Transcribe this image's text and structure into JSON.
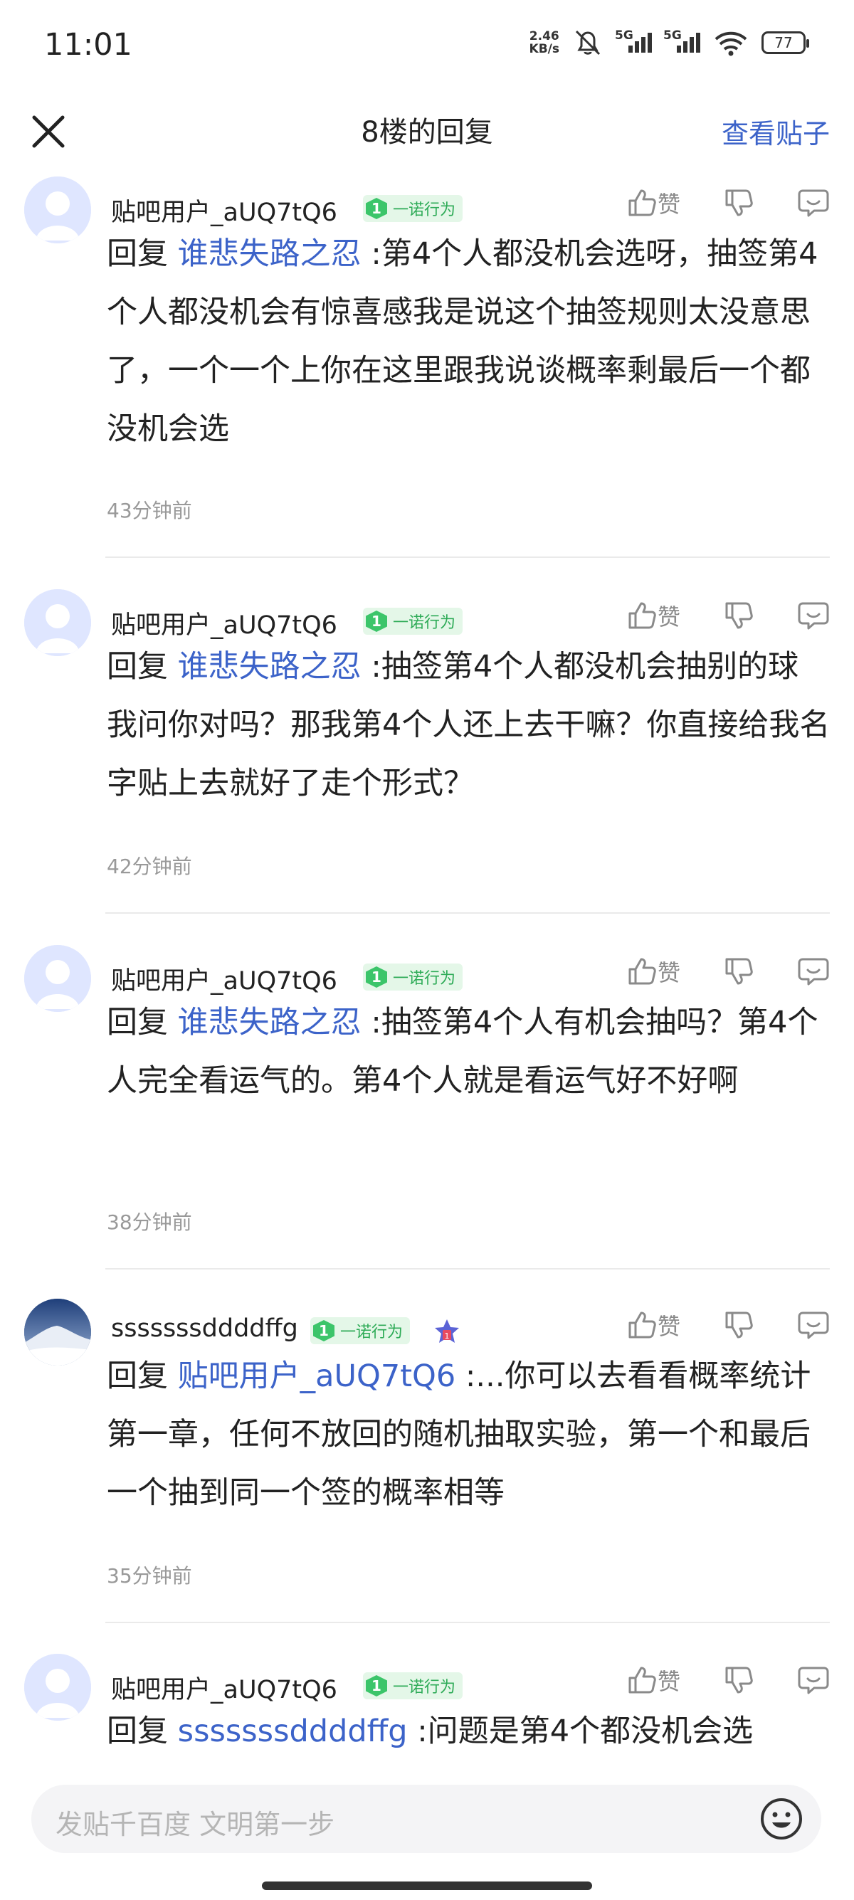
{
  "status_bar": {
    "time": "11:01",
    "net_speed_value": "2.46",
    "net_speed_unit": "KB/s",
    "signal_1": "5G",
    "signal_2": "5G",
    "battery": "77"
  },
  "header": {
    "title": "8楼的回复",
    "view_post": "查看贴子"
  },
  "like_label": "赞",
  "comments": [
    {
      "username": "贴吧用户_aUQ7tQ6",
      "badge_level": "1",
      "badge_text": "一诺行为",
      "reply_prefix": "回复",
      "mention": "谁悲失路之忍",
      "text": " :第4个人都没机会选呀，抽签第4个人都没机会有惊喜感我是说这个抽签规则太没意思了，一个一个上你在这里跟我说谈概率剩最后一个都没机会选",
      "time": "43分钟前"
    },
    {
      "username": "贴吧用户_aUQ7tQ6",
      "badge_level": "1",
      "badge_text": "一诺行为",
      "reply_prefix": "回复",
      "mention": "谁悲失路之忍",
      "text": " :抽签第4个人都没机会抽别的球 我问你对吗？那我第4个人还上去干嘛？你直接给我名字贴上去就好了走个形式？",
      "time": "42分钟前"
    },
    {
      "username": "贴吧用户_aUQ7tQ6",
      "badge_level": "1",
      "badge_text": "一诺行为",
      "reply_prefix": "回复",
      "mention": "谁悲失路之忍",
      "text": " :抽签第4个人有机会抽吗？第4个人完全看运气的。第4个人就是看运气好不好啊",
      "time": "38分钟前"
    },
    {
      "username": "sssssssddddffg",
      "badge_level": "1",
      "badge_text": "一诺行为",
      "reply_prefix": "回复",
      "mention": "贴吧用户_aUQ7tQ6",
      "text": " :...你可以去看看概率统计第一章，任何不放回的随机抽取实验，第一个和最后一个抽到同一个签的概率相等",
      "time": "35分钟前",
      "extra_badge": "1"
    },
    {
      "username": "贴吧用户_aUQ7tQ6",
      "badge_level": "1",
      "badge_text": "一诺行为",
      "reply_prefix": "回复",
      "mention": "sssssssddddffg",
      "text": " :问题是第4个都没机会选"
    }
  ],
  "input": {
    "placeholder": "发贴千百度 文明第一步"
  },
  "colors": {
    "accent": "#3c63c9",
    "badge_green": "#3cc56a",
    "muted": "#999999"
  }
}
